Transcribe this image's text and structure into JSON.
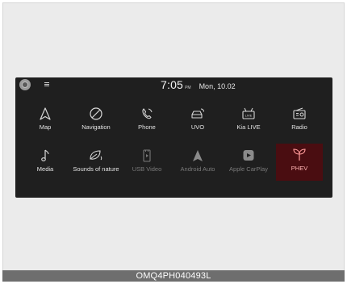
{
  "status": {
    "time": "7:05",
    "ampm": "PM",
    "date": "Mon, 10.02"
  },
  "apps": [
    {
      "label": "Map",
      "icon": "map-arrow-icon",
      "state": "normal"
    },
    {
      "label": "Navigation",
      "icon": "navigation-compass-icon",
      "state": "normal"
    },
    {
      "label": "Phone",
      "icon": "phone-handset-icon",
      "state": "normal"
    },
    {
      "label": "UVO",
      "icon": "uvo-car-icon",
      "state": "normal"
    },
    {
      "label": "Kia LIVE",
      "icon": "kia-live-icon",
      "state": "normal"
    },
    {
      "label": "Radio",
      "icon": "radio-icon",
      "state": "normal"
    },
    {
      "label": "Media",
      "icon": "music-note-icon",
      "state": "normal"
    },
    {
      "label": "Sounds of nature",
      "icon": "leaf-sound-icon",
      "state": "normal"
    },
    {
      "label": "USB Video",
      "icon": "usb-video-icon",
      "state": "disabled"
    },
    {
      "label": "Android Auto",
      "icon": "android-auto-icon",
      "state": "disabled"
    },
    {
      "label": "Apple CarPlay",
      "icon": "apple-carplay-icon",
      "state": "disabled"
    },
    {
      "label": "PHEV",
      "icon": "sprout-icon",
      "state": "selected"
    }
  ],
  "kia_live_badge": "LIVE",
  "caption": "OMQ4PH040493L",
  "colors": {
    "screen_bg": "#1f1f1f",
    "selected_tile_bg": "#4a0d11",
    "selected_text": "#ffb3b3",
    "caption_bg": "#6e6e6e"
  }
}
